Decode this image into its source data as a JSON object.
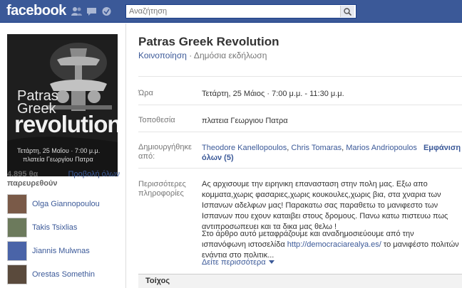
{
  "topbar": {
    "logo": "facebook",
    "search_placeholder": "Αναζήτηση",
    "icons": [
      "friends-icon",
      "messages-icon",
      "notifications-icon"
    ]
  },
  "event": {
    "title": "Patras Greek Revolution",
    "share": "Κοινοποίηση",
    "separator": " · ",
    "type": "Δημόσια εκδήλωση"
  },
  "poster": {
    "line_patras": "Patras",
    "line_greek": "Greek",
    "line_revolution": "revolution",
    "date": "Τετάρτη, 25 Μαΐου  ·  7:00 μ.μ.",
    "place": "πλατεία Γεωργίου Πατρα"
  },
  "attendees": {
    "count": "4.895 θα παρευρεθούν",
    "see_all": "Προβολή όλων",
    "list": [
      {
        "name": "Olga Giannopoulou",
        "color": "#7a5a48"
      },
      {
        "name": "Takis Tsixlias",
        "color": "#6c7a5c"
      },
      {
        "name": "Jiannis Mulwnas",
        "color": "#4a64a8"
      },
      {
        "name": "Orestas Somethin",
        "color": "#5a4a3c"
      }
    ]
  },
  "details": {
    "time_label": "Ώρα",
    "time_value": "Τετάρτη, 25 Μάιος · 7:00 μ.μ. - 11:30 μ.μ.",
    "location_label": "Τοποθεσία",
    "location_value": "πλατεια Γεωργιου Πατρα",
    "created_label": "Δημιουργήθηκε από:",
    "creators": [
      "Theodore Kanellopoulos",
      "Chris Tomaras",
      "Marios Andriopoulos"
    ],
    "show_all": "Εμφάνιση όλων (5)",
    "more_info_label": "Περισσότερες πληροφορίες",
    "paragraph1": "Ας αρχισουμε την ειρηνικη επανασταση στην πολη μας. Εξω απο κομματα,χωρις φασαριες,χωρις κουκουλες,χωρις βια, στα χναρια των Ισπανων αδελφων μας! Παρακατω σας παραθετω το μανιφεστο των Ισπανων που εχουν καταιβει στους δρομους. Πανω κατω πιστευω πως αντιπροσωπευει και τα δικα μας θελω !",
    "paragraph2_start": "Στο άρθρο αυτό μεταφράζουμε και αναδημοσιεύουμε από την ισπανόφωνη ιστοσελίδα ",
    "paragraph2_link": "http://democraciarealya.es/",
    "paragraph2_end": " το μανιφέστο πολιτών ενάντια στο πολιτικ...",
    "see_more": "Δείτε περισσότερα",
    "wall": "Τοίχος"
  }
}
